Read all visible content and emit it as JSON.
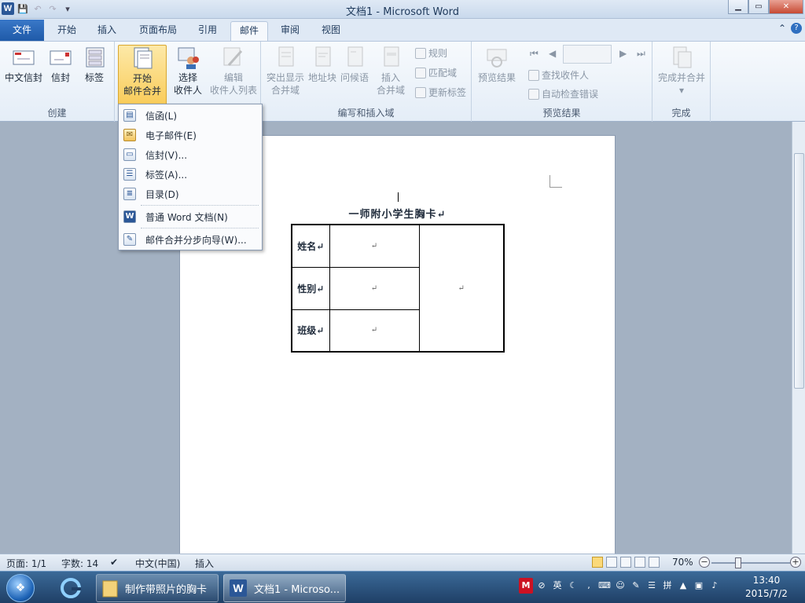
{
  "window": {
    "title": "文档1 - Microsoft Word",
    "app_icon": "W",
    "controls": {
      "minimize": "▁",
      "maximize": "▭",
      "close": "✕"
    }
  },
  "qat": {
    "save_icon": "💾",
    "undo_icon": "↶",
    "redo_icon": "↷",
    "more_icon": "▾"
  },
  "tabs": [
    {
      "label": "文件"
    },
    {
      "label": "开始"
    },
    {
      "label": "插入"
    },
    {
      "label": "页面布局"
    },
    {
      "label": "引用"
    },
    {
      "label": "邮件"
    },
    {
      "label": "审阅"
    },
    {
      "label": "视图"
    }
  ],
  "ribbon": {
    "create_group": {
      "label": "创建",
      "chinese_envelope": "中文信封",
      "envelope": "信封",
      "labels": "标签"
    },
    "start_merge_group": {
      "start_line1": "开始",
      "start_line2": "邮件合并",
      "select_line1": "选择",
      "select_line2": "收件人",
      "edit_line1": "编辑",
      "edit_line2": "收件人列表"
    },
    "write_insert_group": {
      "label": "编写和插入域",
      "highlight_line1": "突出显示",
      "highlight_line2": "合并域",
      "address_block": "地址块",
      "greeting": "问候语",
      "insert_line1": "插入",
      "insert_line2": "合并域",
      "rules": "规则",
      "match_fields": "匹配域",
      "update_labels": "更新标签"
    },
    "preview_group": {
      "label": "预览结果",
      "preview_results": "预览结果",
      "find_recipient": "查找收件人",
      "auto_check": "自动检查错误"
    },
    "finish_group": {
      "label": "完成",
      "finish_merge": "完成并合并"
    }
  },
  "dropdown": {
    "items": [
      {
        "label": "信函(L)",
        "icon": "letter-icon"
      },
      {
        "label": "电子邮件(E)",
        "icon": "email-icon"
      },
      {
        "label": "信封(V)...",
        "icon": "envelope-icon"
      },
      {
        "label": "标签(A)...",
        "icon": "label-icon"
      },
      {
        "label": "目录(D)",
        "icon": "directory-icon"
      },
      {
        "label": "普通 Word 文档(N)",
        "icon": "word-doc-icon"
      },
      {
        "label": "邮件合并分步向导(W)...",
        "icon": "wizard-icon"
      }
    ]
  },
  "document": {
    "title": "一师附小学生胸卡↵",
    "rows": [
      {
        "label": "姓名↵",
        "value": "↵"
      },
      {
        "label": "性别↵",
        "value": "↵"
      },
      {
        "label": "班级↵",
        "value": "↵"
      }
    ],
    "photo_cell": "↵"
  },
  "status": {
    "page": "页面: 1/1",
    "words": "字数: 14",
    "language": "中文(中国)",
    "mode": "插入",
    "zoom": "70%",
    "zoom_minus": "−",
    "zoom_plus": "+"
  },
  "taskbar": {
    "folder_window": "制作带照片的胸卡",
    "word_window": "文档1 - Microso...",
    "tray": {
      "ime_brand": "M",
      "ime_lang": "英"
    },
    "time": "13:40",
    "date": "2015/7/2"
  }
}
